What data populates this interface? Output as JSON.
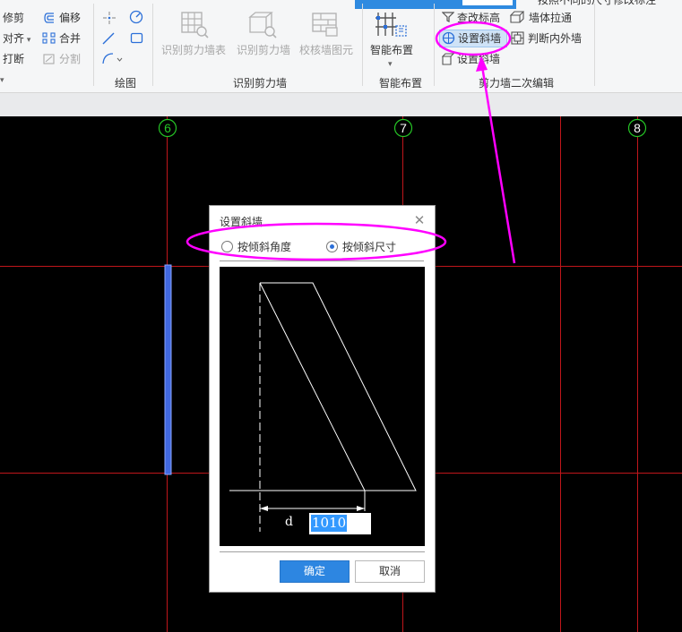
{
  "window": {
    "top_fragment": "按照不同的尺寸修改标注",
    "accent_color": "#2f8ae0"
  },
  "ribbon": {
    "modify_group": {
      "items": [
        {
          "label": "修剪",
          "icon": "trim-icon"
        },
        {
          "label": "偏移",
          "icon": "offset-icon"
        },
        {
          "label": "对齐",
          "icon": "align-icon"
        },
        {
          "label": "合并",
          "icon": "merge-icon"
        },
        {
          "label": "打断",
          "icon": "break-icon"
        },
        {
          "label": "分割",
          "icon": "split-icon"
        }
      ]
    },
    "draw_group": {
      "title": "绘图",
      "tools": [
        "point-icon",
        "arc-icon",
        "line-icon",
        "rectangle-icon",
        "polyline-icon"
      ]
    },
    "recognize_group": {
      "title": "识别剪力墙",
      "buttons": [
        {
          "label": "识别剪力墙表",
          "icon": "recognize-wall-table-icon"
        },
        {
          "label": "识别剪力墙",
          "icon": "recognize-wall-icon"
        },
        {
          "label": "校核墙图元",
          "icon": "check-wall-icon"
        }
      ]
    },
    "smart_group": {
      "title": "智能布置",
      "button_label": "智能布置",
      "icon": "smart-layout-icon"
    },
    "edit_group": {
      "title": "剪力墙二次编辑",
      "items": [
        {
          "label": "查改标高",
          "icon": "elevation-icon"
        },
        {
          "label": "墙体拉通",
          "icon": "wall-extend-icon"
        },
        {
          "label": "设置斜墙",
          "icon": "slant-wall-icon"
        },
        {
          "label": "判断内外墙",
          "icon": "inner-outer-wall-icon"
        },
        {
          "label": "设置斜墙",
          "icon": "slant-wall-alt-icon"
        }
      ]
    }
  },
  "canvas": {
    "axes": [
      {
        "label": "6"
      },
      {
        "label": "7"
      },
      {
        "label": "8"
      }
    ],
    "grid_color": "#c0161b",
    "axis_label_color": "#26c626",
    "wall_color": "#4169e1"
  },
  "dialog": {
    "title": "设置斜墙",
    "close_symbol": "✕",
    "options": [
      {
        "label": "按倾斜角度",
        "selected": false
      },
      {
        "label": "按倾斜尺寸",
        "selected": true
      }
    ],
    "dimension_label": "d",
    "dimension_value": "1010",
    "ok_label": "确定",
    "cancel_label": "取消"
  },
  "annotation": {
    "highlight_color": "#ff00ff"
  }
}
